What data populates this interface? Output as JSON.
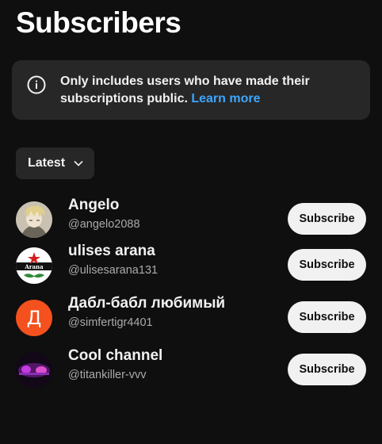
{
  "page": {
    "title": "Subscribers"
  },
  "info": {
    "text": "Only includes users who have made their subscriptions public.",
    "link": "Learn more"
  },
  "sort": {
    "selected": "Latest"
  },
  "subscribers": [
    {
      "name": "Angelo",
      "handle": "@angelo2088",
      "button": "Subscribe"
    },
    {
      "name": "ulises arana",
      "handle": "@ulisesarana131",
      "button": "Subscribe",
      "avatar_text": "Arana"
    },
    {
      "name": "Дабл-бабл любимый",
      "handle": "@simfertigr4401",
      "button": "Subscribe",
      "avatar_letter": "Д"
    },
    {
      "name": "Cool channel",
      "handle": "@titankiller-vvv",
      "button": "Subscribe"
    }
  ],
  "colors": {
    "background": "#0f0f0f",
    "card": "#272727",
    "link": "#3ea6ff",
    "button_bg": "#f1f1f1",
    "letter_avatar": "#f4511e"
  }
}
